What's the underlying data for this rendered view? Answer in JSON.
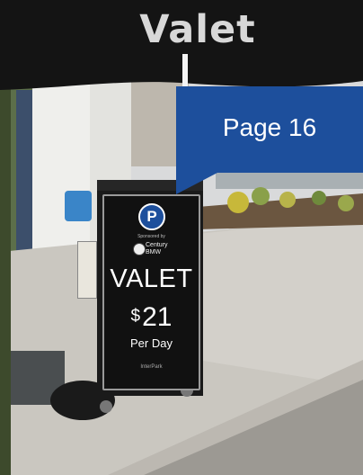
{
  "umbrella": {
    "text": "Valet"
  },
  "badge": {
    "label": "Page 16"
  },
  "sign": {
    "parking_symbol": "P",
    "sponsor_line": "Sponsored by",
    "brand": "Century\nBMW",
    "headline": "VALET",
    "currency": "$",
    "price": "21",
    "period": "Per Day",
    "footer": "InterPark"
  },
  "colors": {
    "badge_blue": "#1d4f9c",
    "umbrella_black": "#141414",
    "sky_white": "#e4e4e4",
    "pavement": "#c9c6bf",
    "greenery": "#6f8a3c"
  }
}
